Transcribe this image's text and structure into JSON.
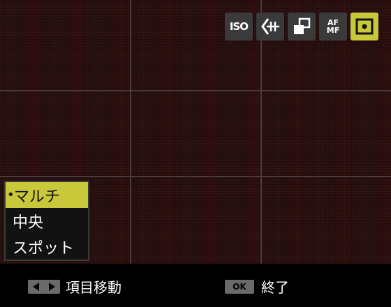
{
  "toolbar": {
    "icons": [
      {
        "name": "iso-icon",
        "text": "ISO"
      },
      {
        "name": "white-balance-icon"
      },
      {
        "name": "drive-mode-icon"
      },
      {
        "name": "af-mf-icon",
        "text_top": "AF",
        "text_bottom": "MF"
      },
      {
        "name": "metering-icon",
        "selected": true
      }
    ]
  },
  "metering_menu": {
    "items": [
      {
        "label": "マルチ",
        "selected": true
      },
      {
        "label": "中央",
        "selected": false
      },
      {
        "label": "スポット",
        "selected": false
      }
    ],
    "selected_bullet": "•"
  },
  "footer": {
    "left_hint": "項目移動",
    "ok_key_label": "OK",
    "right_hint": "終了"
  },
  "colors": {
    "accent": "#c8c83a",
    "background": "#1f0c0c",
    "icon_bg": "#3a3a3a",
    "grid": "#4d3a3a"
  }
}
